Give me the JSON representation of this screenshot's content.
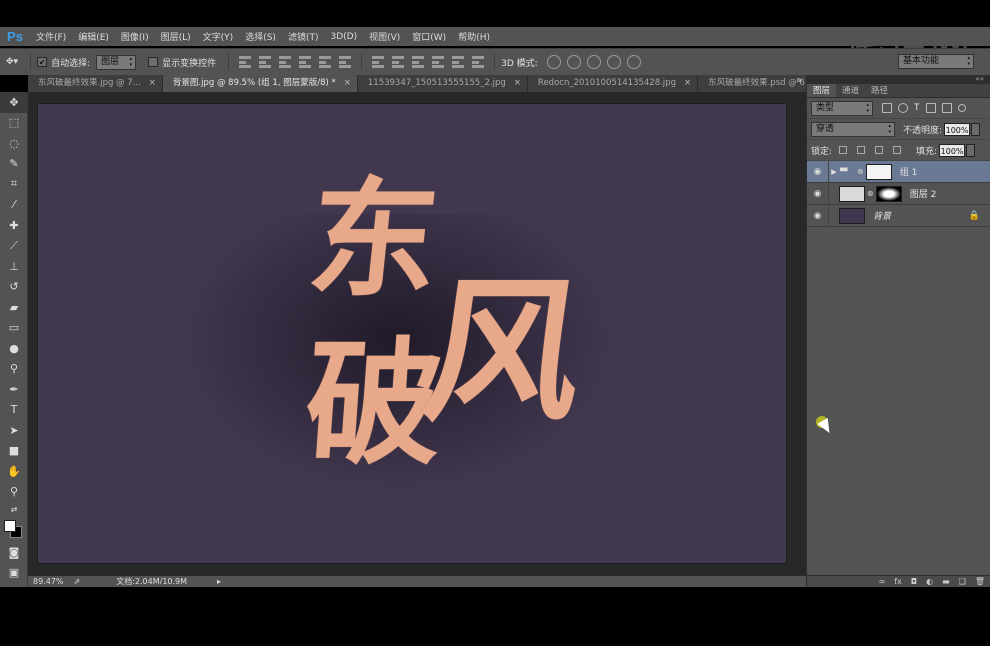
{
  "app": {
    "logo": "Ps"
  },
  "watermark": {
    "text": "虎课网"
  },
  "menu": [
    "文件(F)",
    "编辑(E)",
    "图像(I)",
    "图层(L)",
    "文字(Y)",
    "选择(S)",
    "滤镜(T)",
    "3D(D)",
    "视图(V)",
    "窗口(W)",
    "帮助(H)"
  ],
  "options": {
    "auto_select_label": "自动选择:",
    "auto_select_value": "图层",
    "show_transform_label": "显示变换控件",
    "mode_3d_label": "3D 模式:",
    "workspace": "基本功能"
  },
  "tabs": [
    {
      "label": "东风破最终效果.jpg @ 7...",
      "active": false
    },
    {
      "label": "背景图.jpg @ 89.5% (组 1, 图层蒙版/8) *",
      "active": true
    },
    {
      "label": "11539347_150513555155_2.jpg",
      "active": false
    },
    {
      "label": "Redocn_2010100514135428.jpg",
      "active": false
    },
    {
      "label": "东风破最终效果.psd @ 6",
      "active": false
    }
  ],
  "tab_overflow": "»",
  "canvas": {
    "text1": "东",
    "text2": "破",
    "text3": "风",
    "background_color": "#41374f",
    "text_color": "#e8a88a"
  },
  "status": {
    "zoom": "89.47%",
    "doc": "文档:2.04M/10.9M"
  },
  "panel": {
    "tabs": [
      "图层",
      "通道",
      "路径"
    ],
    "filter_kind": "类型",
    "blend_mode": "穿透",
    "opacity_label": "不透明度:",
    "opacity_value": "100%",
    "lock_label": "锁定:",
    "fill_label": "填充:",
    "fill_value": "100%",
    "layers": [
      {
        "name": "组 1",
        "selected": true
      },
      {
        "name": "图层 2",
        "selected": false
      },
      {
        "name": "背景",
        "selected": false
      }
    ]
  }
}
